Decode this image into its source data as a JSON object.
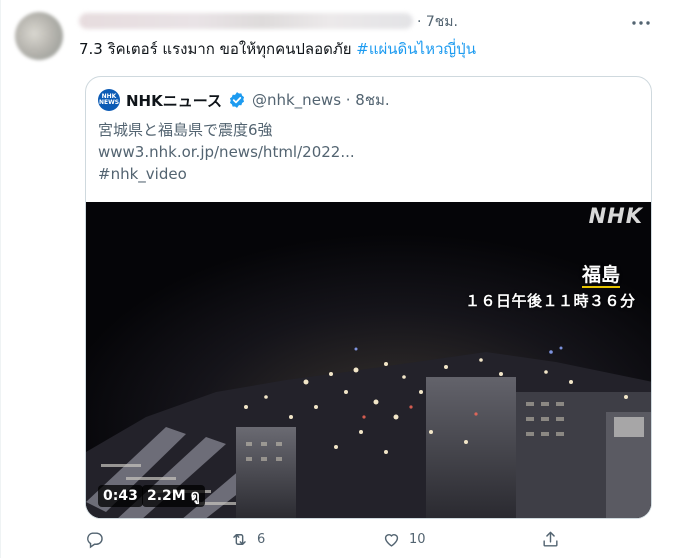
{
  "tweet": {
    "time": "· 7ชม.",
    "text": "7.3 ริคเตอร์ แรงมาก ขอให้ทุกคนปลอดภัย ",
    "hashtag": "#แผ่นดินไหวญี่ปุ่น"
  },
  "quote": {
    "logo_line1": "NHK",
    "logo_line2": "NEWS",
    "name": "NHKニュース",
    "handle": "@nhk_news · 8ชม.",
    "lines": [
      "宮城県と福島県で震度6強",
      "www3.nhk.or.jp/news/html/2022...",
      "#nhk_video"
    ]
  },
  "media": {
    "watermark": "NHK",
    "location": "福島",
    "timestamp": "１６日午後１１時３６分",
    "duration": "0:43",
    "views": "2.2M ดู"
  },
  "actions": {
    "retweets": "6",
    "likes": "10"
  },
  "colors": {
    "accent": "#1d9bf0",
    "muted": "#536471",
    "border": "#cfd9de"
  }
}
